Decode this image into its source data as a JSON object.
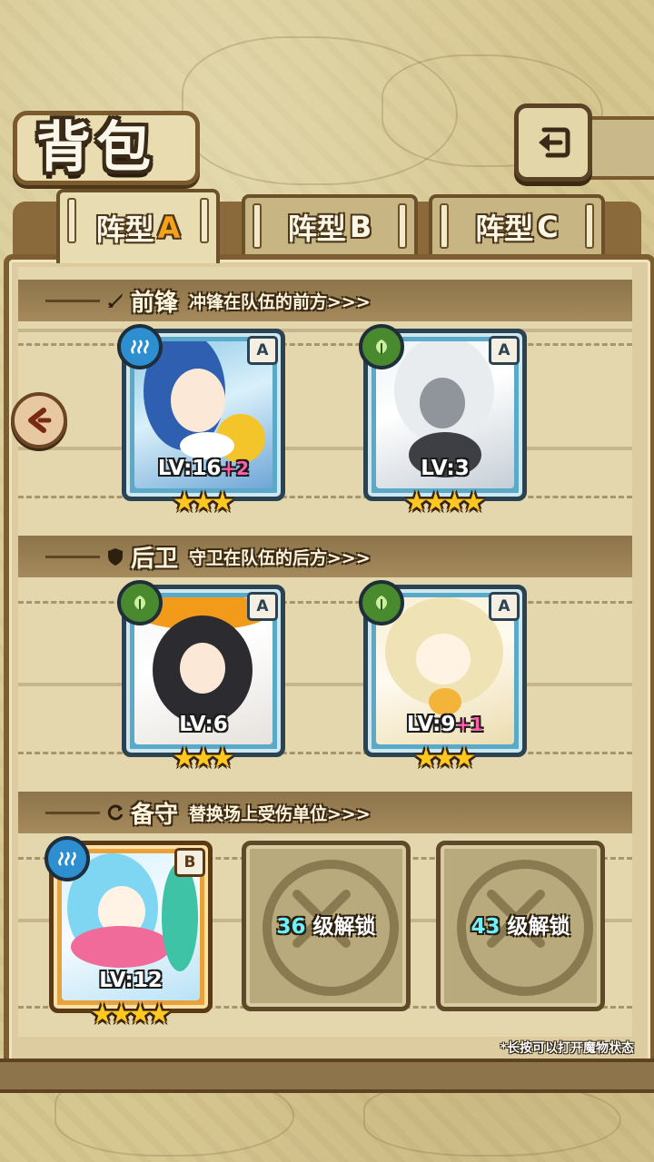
{
  "screen": {
    "title": "背包"
  },
  "tabs": [
    {
      "label": "阵型",
      "suffix": "A",
      "active": true
    },
    {
      "label": "阵型",
      "suffix": "B",
      "active": false
    },
    {
      "label": "阵型",
      "suffix": "C",
      "active": false
    }
  ],
  "sections": {
    "front": {
      "title": "前锋",
      "desc": "冲锋在队伍的前方>>>"
    },
    "back": {
      "title": "后卫",
      "desc": "守卫在队伍的后方>>>"
    },
    "reserve": {
      "title": "备守",
      "desc": "替换场上受伤单位>>>"
    }
  },
  "units": {
    "front1": {
      "attr": "water-icon",
      "grade": "A",
      "lv": "LV:16",
      "bonus": "+2",
      "stars": 3
    },
    "front2": {
      "attr": "leaf-icon",
      "grade": "A",
      "lv": "LV:3",
      "bonus": "",
      "stars": 4
    },
    "back1": {
      "attr": "leaf-icon",
      "grade": "A",
      "lv": "LV:6",
      "bonus": "",
      "stars": 3
    },
    "back2": {
      "attr": "leaf-icon",
      "grade": "A",
      "lv": "LV:9",
      "bonus": "+1",
      "stars": 3
    },
    "reserve1": {
      "attr": "water-icon",
      "grade": "B",
      "lv": "LV:12",
      "bonus": "",
      "stars": 4
    }
  },
  "locked_slots": [
    {
      "level": "36",
      "text": "级解锁"
    },
    {
      "level": "43",
      "text": "级解锁"
    }
  ],
  "hint": "*长按可以打开魔物状态",
  "colors": {
    "accent": "#f3a21a",
    "frame": "#7d5e30",
    "star": "#ffc821",
    "bonus": "#ff5ea8",
    "unlock_level": "#6ff0ff"
  }
}
